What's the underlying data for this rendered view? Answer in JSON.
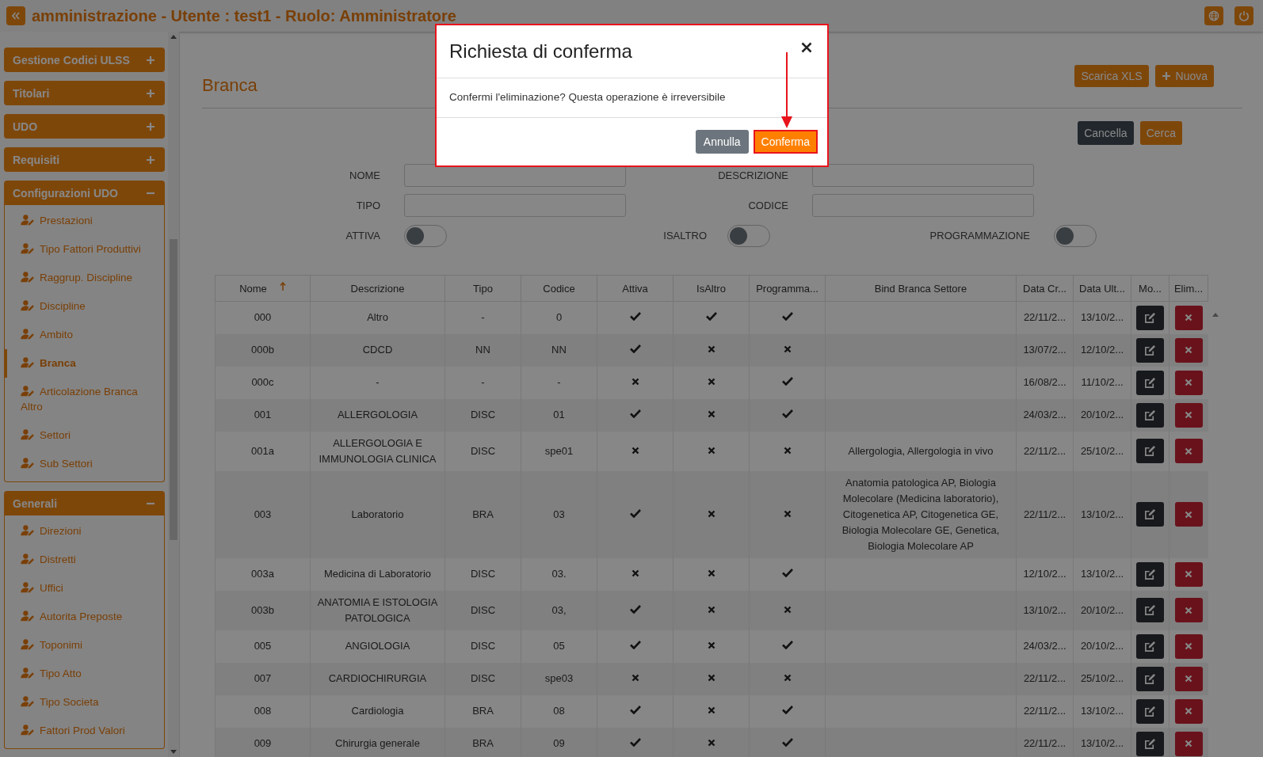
{
  "header": {
    "title": "amministrazione - Utente : test1 - Ruolo: Amministratore"
  },
  "sidebar": {
    "groups": [
      {
        "title": "Gestione Codici ULSS",
        "expanded": false
      },
      {
        "title": "Titolari",
        "expanded": false
      },
      {
        "title": "UDO",
        "expanded": false
      },
      {
        "title": "Requisiti",
        "expanded": false
      },
      {
        "title": "Configurazioni UDO",
        "expanded": true,
        "items": [
          {
            "label": "Prestazioni",
            "selected": false
          },
          {
            "label": "Tipo Fattori Produttivi",
            "selected": false
          },
          {
            "label": "Raggrup. Discipline",
            "selected": false
          },
          {
            "label": "Discipline",
            "selected": false
          },
          {
            "label": "Ambito",
            "selected": false
          },
          {
            "label": "Branca",
            "selected": true
          },
          {
            "label": "Articolazione Branca Altro",
            "selected": false
          },
          {
            "label": "Settori",
            "selected": false
          },
          {
            "label": "Sub Settori",
            "selected": false
          }
        ]
      },
      {
        "title": "Generali",
        "expanded": true,
        "items": [
          {
            "label": "Direzioni",
            "selected": false
          },
          {
            "label": "Distretti",
            "selected": false
          },
          {
            "label": "Uffici",
            "selected": false
          },
          {
            "label": "Autorita Preposte",
            "selected": false
          },
          {
            "label": "Toponimi",
            "selected": false
          },
          {
            "label": "Tipo Atto",
            "selected": false
          },
          {
            "label": "Tipo Societa",
            "selected": false
          },
          {
            "label": "Fattori Prod Valori",
            "selected": false
          }
        ]
      }
    ]
  },
  "page": {
    "title": "Branca",
    "actions": [
      {
        "label": "Scarica XLS",
        "kind": "download"
      },
      {
        "label": "Nuova",
        "kind": "new"
      }
    ]
  },
  "filters": {
    "buttons": [
      {
        "label": "Cancella",
        "kind": "secondary"
      },
      {
        "label": "Cerca",
        "kind": "primary"
      }
    ],
    "fields": [
      {
        "label": "NOME"
      },
      {
        "label": "DESCRIZIONE"
      },
      {
        "label": "TIPO"
      },
      {
        "label": "CODICE"
      }
    ],
    "toggles": [
      {
        "label": "ATTIVA",
        "on": false
      },
      {
        "label": "ISALTRO",
        "on": false
      },
      {
        "label": "PROGRAMMAZIONE",
        "on": false
      }
    ]
  },
  "table": {
    "columns": [
      {
        "label": "Nome",
        "sorted": true
      },
      {
        "label": "Descrizione",
        "sorted": false
      },
      {
        "label": "Tipo",
        "sorted": false
      },
      {
        "label": "Codice",
        "sorted": false
      },
      {
        "label": "Attiva",
        "sorted": false
      },
      {
        "label": "IsAltro",
        "sorted": false
      },
      {
        "label": "Programma...",
        "sorted": false
      },
      {
        "label": "Bind Branca Settore",
        "sorted": false
      },
      {
        "label": "Data Cr...",
        "sorted": false
      },
      {
        "label": "Data Ult...",
        "sorted": false
      },
      {
        "label": "Mo...",
        "sorted": false
      },
      {
        "label": "Elim...",
        "sorted": false
      }
    ],
    "rows": [
      {
        "nome": "000",
        "descrizione": "Altro",
        "tipo": "-",
        "codice": "0",
        "attiva": true,
        "isaltro": true,
        "programmazione": true,
        "data_creazione": "22/11/2...",
        "data_ultima": "13/10/2..."
      },
      {
        "nome": "000b",
        "descrizione": "CDCD",
        "tipo": "NN",
        "codice": "NN",
        "attiva": true,
        "isaltro": false,
        "programmazione": false,
        "data_creazione": "13/07/2...",
        "data_ultima": "12/10/2..."
      },
      {
        "nome": "000c",
        "descrizione": "-",
        "tipo": "-",
        "codice": "-",
        "attiva": false,
        "isaltro": false,
        "programmazione": true,
        "data_creazione": "16/08/2...",
        "data_ultima": "11/10/2..."
      },
      {
        "nome": "001",
        "descrizione": "ALLERGOLOGIA",
        "tipo": "DISC",
        "codice": "01",
        "attiva": true,
        "isaltro": false,
        "programmazione": true,
        "data_creazione": "24/03/2...",
        "data_ultima": "20/10/2..."
      },
      {
        "nome": "001a",
        "descrizione": "ALLERGOLOGIA E IMMUNOLOGIA CLINICA",
        "tipo": "DISC",
        "codice": "spe01",
        "attiva": false,
        "isaltro": false,
        "programmazione": false,
        "bind": "Allergologia, Allergologia in vivo",
        "data_creazione": "22/11/2...",
        "data_ultima": "25/10/2..."
      },
      {
        "nome": "003",
        "descrizione": "Laboratorio",
        "tipo": "BRA",
        "codice": "03",
        "attiva": true,
        "isaltro": false,
        "programmazione": false,
        "bind": "Anatomia patologica AP, Biologia Molecolare (Medicina laboratorio), Citogenetica AP, Citogenetica GE, Biologia Molecolare GE, Genetica, Biologia Molecolare AP",
        "data_creazione": "22/11/2...",
        "data_ultima": "13/10/2..."
      },
      {
        "nome": "003a",
        "descrizione": "Medicina di Laboratorio",
        "tipo": "DISC",
        "codice": "03.",
        "attiva": false,
        "isaltro": false,
        "programmazione": true,
        "data_creazione": "12/10/2...",
        "data_ultima": "13/10/2..."
      },
      {
        "nome": "003b",
        "descrizione": "ANATOMIA E ISTOLOGIA PATOLOGICA",
        "tipo": "DISC",
        "codice": "03,",
        "attiva": true,
        "isaltro": false,
        "programmazione": false,
        "data_creazione": "13/10/2...",
        "data_ultima": "20/10/2..."
      },
      {
        "nome": "005",
        "descrizione": "ANGIOLOGIA",
        "tipo": "DISC",
        "codice": "05",
        "attiva": true,
        "isaltro": false,
        "programmazione": true,
        "data_creazione": "24/03/2...",
        "data_ultima": "20/10/2..."
      },
      {
        "nome": "007",
        "descrizione": "CARDIOCHIRURGIA",
        "tipo": "DISC",
        "codice": "spe03",
        "attiva": false,
        "isaltro": false,
        "programmazione": false,
        "data_creazione": "22/11/2...",
        "data_ultima": "25/10/2..."
      },
      {
        "nome": "008",
        "descrizione": "Cardiologia",
        "tipo": "BRA",
        "codice": "08",
        "attiva": true,
        "isaltro": false,
        "programmazione": true,
        "data_creazione": "22/11/2...",
        "data_ultima": "13/10/2..."
      },
      {
        "nome": "009",
        "descrizione": "Chirurgia generale",
        "tipo": "BRA",
        "codice": "09",
        "attiva": true,
        "isaltro": false,
        "programmazione": true,
        "data_creazione": "22/11/2...",
        "data_ultima": "13/10/2..."
      }
    ]
  },
  "dialog": {
    "title": "Richiesta di conferma",
    "message": "Confermi l'eliminazione? Questa operazione è irreversibile",
    "buttons": [
      {
        "label": "Annulla",
        "kind": "secondary",
        "highlighted": false
      },
      {
        "label": "Conferma",
        "kind": "primary",
        "highlighted": true
      }
    ]
  }
}
